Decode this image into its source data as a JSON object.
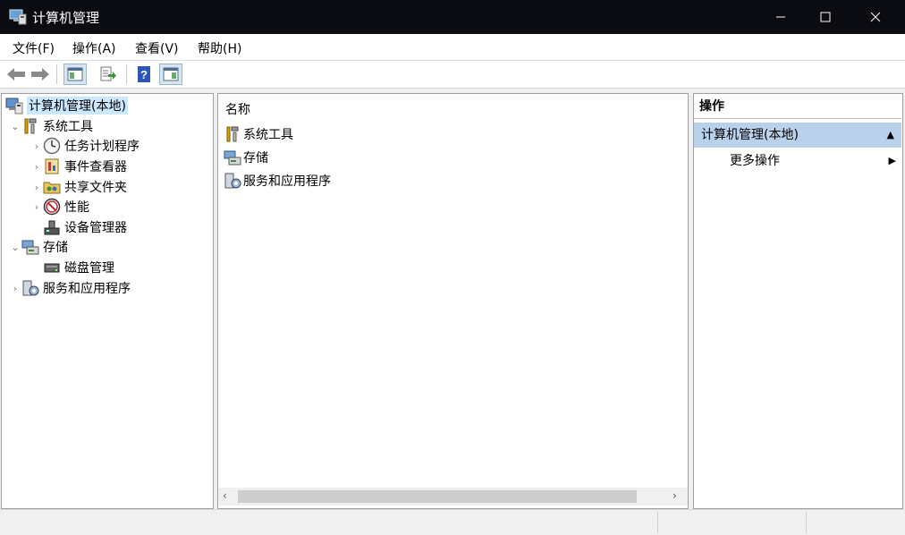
{
  "window": {
    "title": "计算机管理"
  },
  "menu": [
    "文件(F)",
    "操作(A)",
    "查看(V)",
    "帮助(H)"
  ],
  "tree": {
    "root": "计算机管理(本地)",
    "items": [
      {
        "label": "系统工具",
        "icon": "tools-icon"
      },
      {
        "label": "任务计划程序",
        "icon": "clock-icon"
      },
      {
        "label": "事件查看器",
        "icon": "event-viewer-icon"
      },
      {
        "label": "共享文件夹",
        "icon": "shared-folder-icon"
      },
      {
        "label": "性能",
        "icon": "performance-icon"
      },
      {
        "label": "设备管理器",
        "icon": "device-manager-icon"
      },
      {
        "label": "存储",
        "icon": "storage-icon"
      },
      {
        "label": "磁盘管理",
        "icon": "disk-icon"
      },
      {
        "label": "服务和应用程序",
        "icon": "services-icon"
      }
    ]
  },
  "list": {
    "header": "名称",
    "items": [
      {
        "label": "系统工具",
        "icon": "tools-icon"
      },
      {
        "label": "存储",
        "icon": "storage-icon"
      },
      {
        "label": "服务和应用程序",
        "icon": "services-icon"
      }
    ]
  },
  "actions": {
    "header": "操作",
    "section": "计算机管理(本地)",
    "item": "更多操作"
  }
}
